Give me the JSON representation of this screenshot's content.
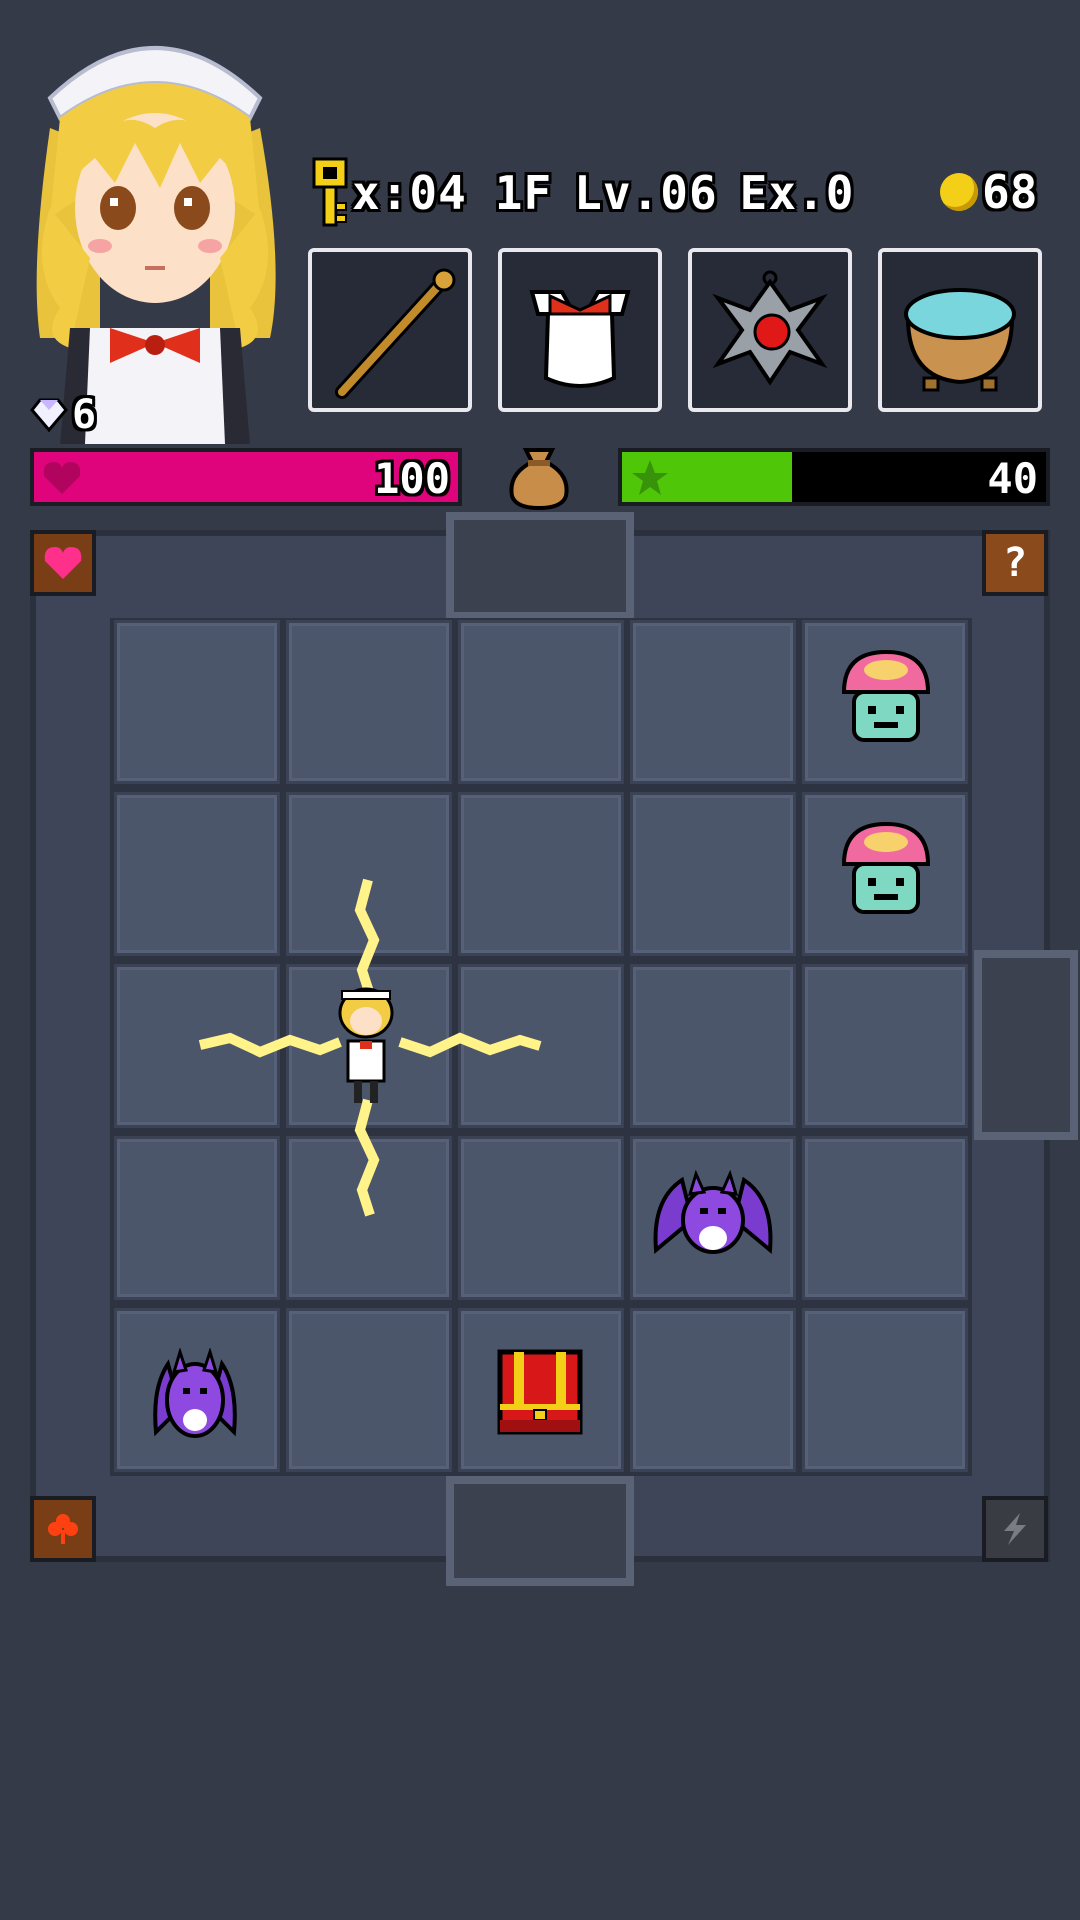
{
  "header": {
    "keys_text": "x:04",
    "floor_text": "1F",
    "level_text": "Lv.06",
    "exp_text": "Ex.0",
    "gold_text": "68",
    "gems_text": "6"
  },
  "equipment": [
    {
      "name": "wooden-staff"
    },
    {
      "name": "maid-apron"
    },
    {
      "name": "ruby-amulet"
    },
    {
      "name": "cauldron-pot"
    }
  ],
  "hp": {
    "value_text": "100",
    "fill_fraction": 1.0,
    "color": "#e0047c"
  },
  "xp": {
    "value_text": "40",
    "fill_fraction": 0.4,
    "color": "#4fc608"
  },
  "grid": {
    "rows": 5,
    "cols": 5
  },
  "colors": {
    "background": "#353a48",
    "tile": "#4c566b",
    "gold": "#f4cf17"
  }
}
